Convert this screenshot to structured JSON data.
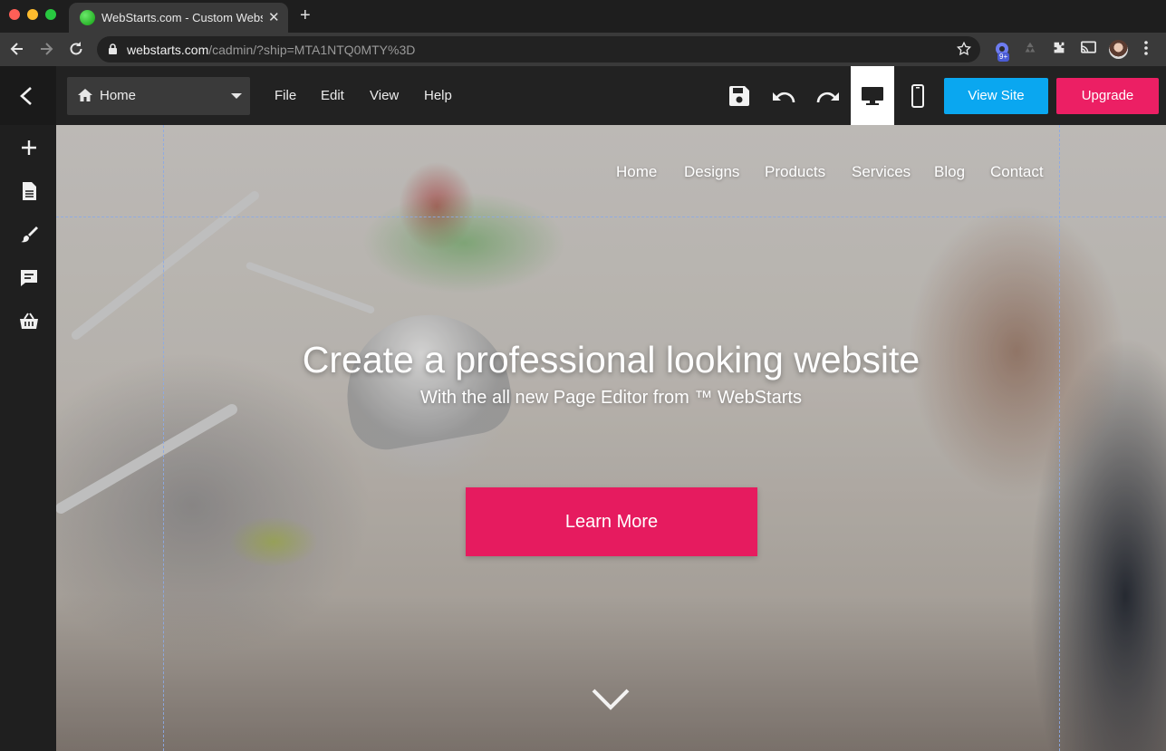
{
  "browser": {
    "tab_title": "WebStarts.com - Custom Website",
    "url_host": "webstarts.com",
    "url_path": "/cadmin/?ship=MTA1NTQ0MTY%3D",
    "extension_badge": "9+"
  },
  "editor": {
    "page_selector": "Home",
    "menu": [
      "File",
      "Edit",
      "View",
      "Help"
    ],
    "view_site_label": "View Site",
    "upgrade_label": "Upgrade"
  },
  "colors": {
    "view_site": "#0aa7f0",
    "upgrade": "#ec1f64",
    "learn_more": "#e61b5f"
  },
  "sidebar_icons": [
    "add-icon",
    "page-icon",
    "brush-icon",
    "comment-icon",
    "store-icon"
  ],
  "site": {
    "nav": [
      "Home",
      "Designs",
      "Products",
      "Services",
      "Blog",
      "Contact"
    ],
    "hero_title": "Create a professional looking website",
    "hero_subtitle": "With the all new Page Editor from ™ WebStarts",
    "cta_label": "Learn More"
  }
}
